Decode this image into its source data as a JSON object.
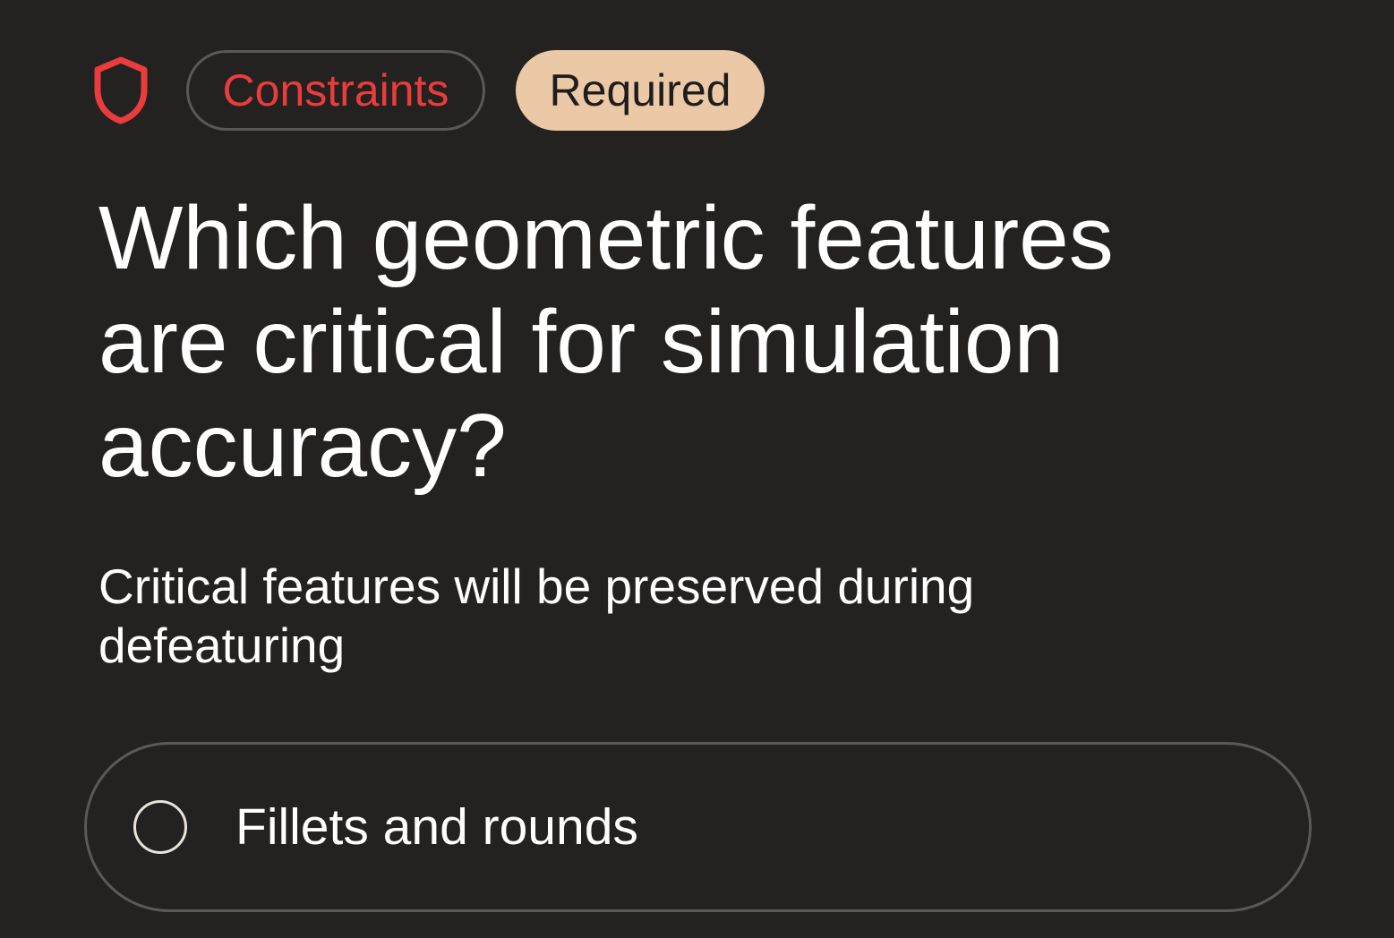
{
  "header": {
    "icon": "shield-icon",
    "category_badge": "Constraints",
    "required_badge": "Required"
  },
  "question": {
    "title": "Which geometric features are critical for simulation accuracy?",
    "subtitle": "Critical features will be preserved during defeaturing"
  },
  "options": [
    {
      "label": "Fillets and rounds",
      "selected": false
    }
  ],
  "colors": {
    "background": "#232221",
    "accent_red": "#ea3c3c",
    "required_badge_bg": "#ebc8a6",
    "border_gray": "#5a5958"
  }
}
